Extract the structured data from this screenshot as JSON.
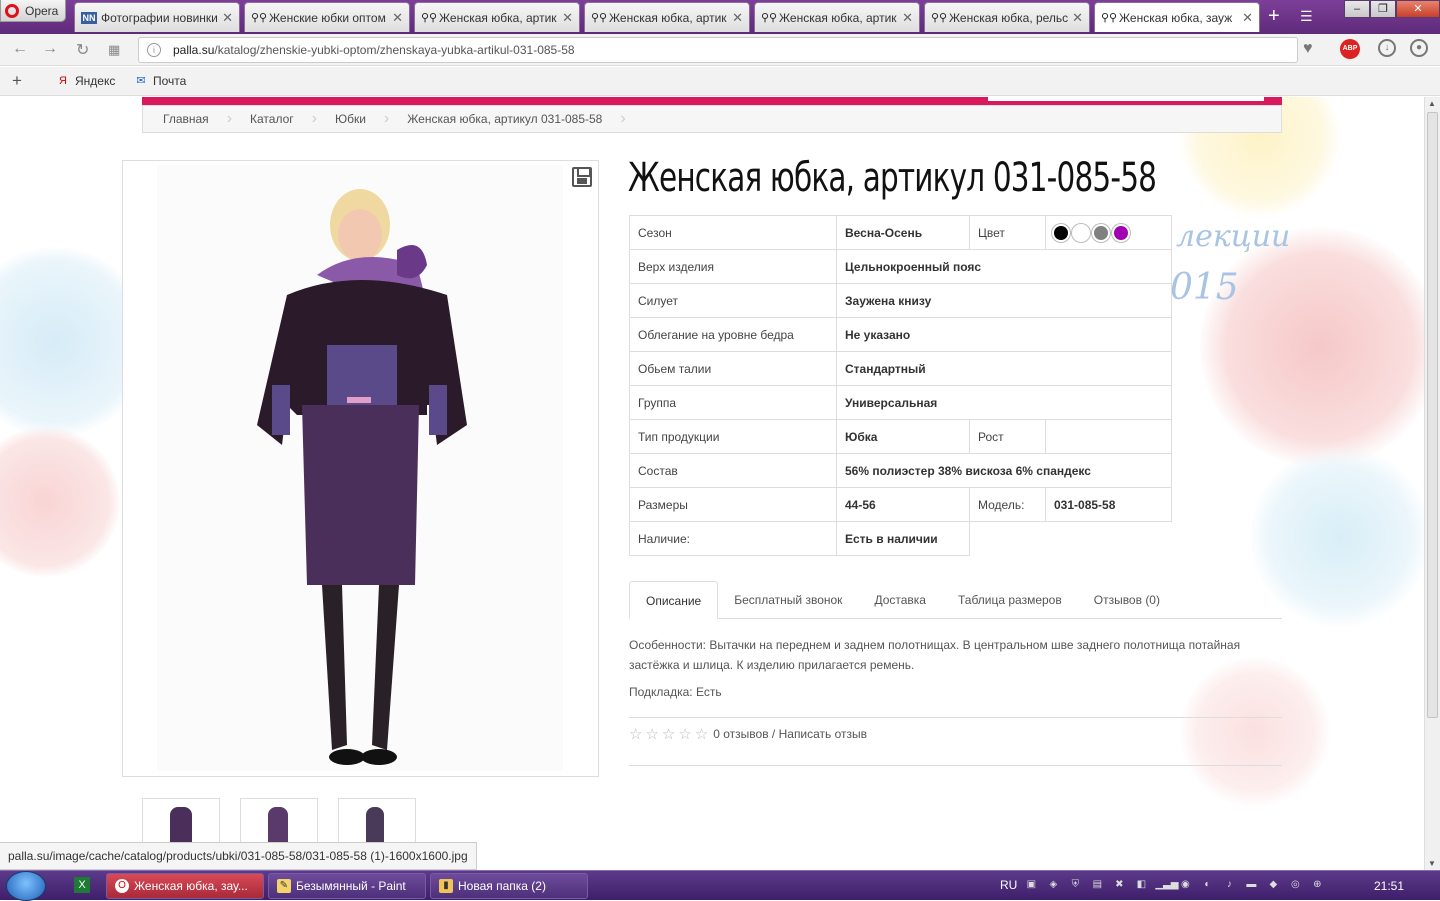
{
  "browser": {
    "app_label": "Opera",
    "tabs": [
      {
        "label": "Фотографии новинки",
        "icon": "NN"
      },
      {
        "label": "Женские юбки оптом",
        "icon": "figures"
      },
      {
        "label": "Женская юбка, артик",
        "icon": "figures"
      },
      {
        "label": "Женская юбка, артик",
        "icon": "figures"
      },
      {
        "label": "Женская юбка, артик",
        "icon": "figures"
      },
      {
        "label": "Женская юбка, рельс",
        "icon": "figures"
      },
      {
        "label": "Женская юбка, зауж",
        "icon": "figures"
      }
    ],
    "url_domain": "palla.su",
    "url_path": "/katalog/zhenskie-yubki-optom/zhenskaya-yubka-artikul-031-085-58",
    "abp_label": "ABP",
    "bookmarks": [
      {
        "label": "Яндекс",
        "icon": "Я"
      },
      {
        "label": "Почта",
        "icon": "✉"
      }
    ]
  },
  "breadcrumb": [
    "Главная",
    "Каталог",
    "Юбки",
    "Женская юбка, артикул 031-085-58"
  ],
  "product": {
    "title": "Женская юбка, артикул 031-085-58",
    "specs": {
      "season_label": "Сезон",
      "season_value": "Весна-Осень",
      "color_label": "Цвет",
      "colors": [
        "#000000",
        "#ffffff",
        "#808080",
        "#a000b0"
      ],
      "top_label": "Верх изделия",
      "top_value": "Цельнокроенный пояс",
      "silhouette_label": "Силует",
      "silhouette_value": "Заужена книзу",
      "hip_label": "Облегание на уровне бедра",
      "hip_value": "Не указано",
      "waist_label": "Обьем талии",
      "waist_value": "Стандартный",
      "group_label": "Группа",
      "group_value": "Универсальная",
      "type_label": "Тип продукции",
      "type_value": "Юбка",
      "height_label": "Рост",
      "height_value": "",
      "composition_label": "Состав",
      "composition_value": "56% полиэстер 38% вискоза 6% спандекс",
      "sizes_label": "Размеры",
      "sizes_value": "44-56",
      "model_label": "Модель:",
      "model_value": "031-085-58",
      "avail_label": "Наличие:",
      "avail_value": "Есть в наличии"
    },
    "tabs": [
      "Описание",
      "Бесплатный звонок",
      "Доставка",
      "Таблица размеров",
      "Отзывов (0)"
    ],
    "description": "Особенности: Вытачки на переднем и заднем полотнищах. В центральном шве заднего полотнища потайная застёжка и шлица. К изделию прилагается ремень.",
    "lining": "Подкладка: Есть",
    "rating": 0,
    "reviews_text": "0 отзывов / Написать отзыв"
  },
  "decor": {
    "line1": "лекции",
    "line2": "015"
  },
  "statusbar": {
    "url": "palla.su/image/cache/catalog/products/ubki/031-085-58/031-085-58 (1)-1600x1600.jpg"
  },
  "taskbar": {
    "tasks": [
      {
        "label": "Женская юбка, зау...",
        "active": true
      },
      {
        "label": "Безымянный - Paint",
        "active": false
      },
      {
        "label": "Новая папка (2)",
        "active": false
      }
    ],
    "lang": "RU",
    "clock": "21:51"
  }
}
